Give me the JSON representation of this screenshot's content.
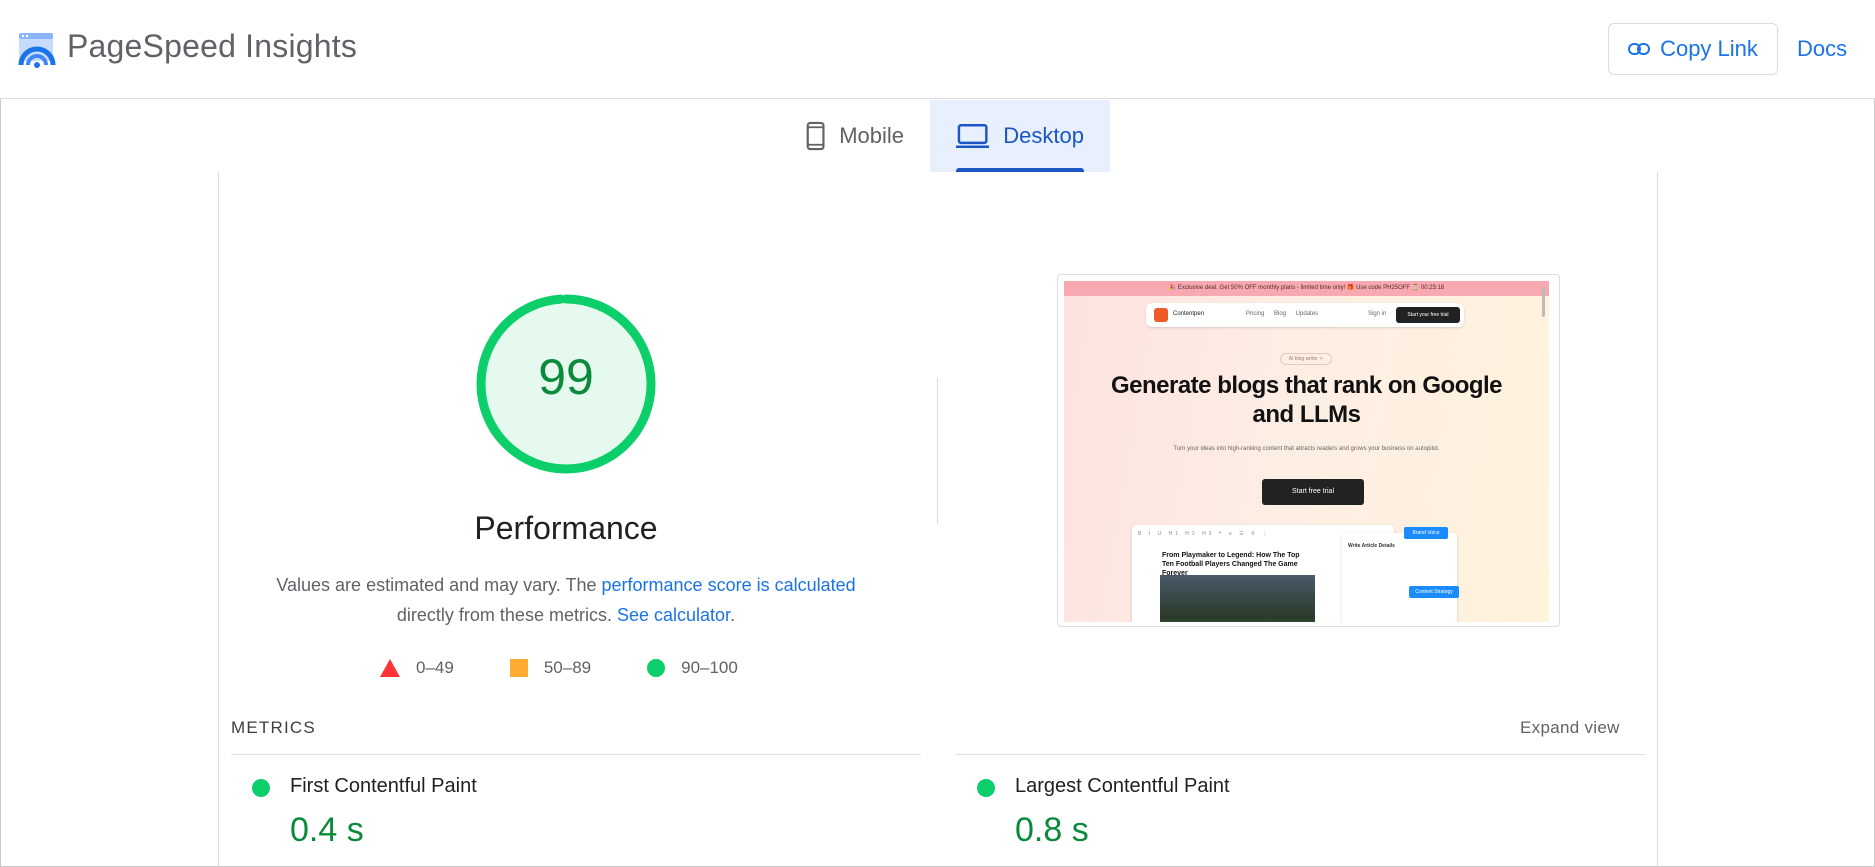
{
  "header": {
    "app_title": "PageSpeed Insights",
    "copy_link_label": "Copy Link",
    "docs_label": "Docs"
  },
  "tabs": [
    {
      "label": "Mobile",
      "icon": "smartphone-icon",
      "active": false
    },
    {
      "label": "Desktop",
      "icon": "laptop-icon",
      "active": true
    }
  ],
  "performance": {
    "score": "99",
    "score_value": 99,
    "title": "Performance",
    "desc_prefix": "Values are estimated and may vary. The ",
    "desc_link": "performance score is calculated",
    "desc_middle": "directly from these metrics.",
    "calculator_link": "See calculator",
    "desc_suffix": "."
  },
  "legend": [
    {
      "range": "0–49",
      "shape": "triangle",
      "color": "#ff3333"
    },
    {
      "range": "50–89",
      "shape": "square",
      "color": "#ffaa33"
    },
    {
      "range": "90–100",
      "shape": "circle",
      "color": "#0cce6b"
    }
  ],
  "screenshot": {
    "banner": "🎉 Exclusive deal. Get 50% OFF monthly plans - limited time only! 🎁 Use code PH25OFF ⏳ 00:25:18",
    "brand": "Contentpen",
    "nav_links": "Pricing Blog Updates",
    "sign_in": "Sign in",
    "nav_cta": "Start your free trial",
    "pill": "AI blog writer ✧",
    "headline": "Generate blogs that rank on Google and LLMs",
    "subhead": "Turn your ideas into high-ranking content that attracts readers and grows your business on autopilot.",
    "cta": "Start free trial",
    "editor_toolbar": "B I U H1 H2 H3 ❝ ≡ ☰ ⚲ ⋮",
    "editor_title": "From Playmaker to Legend: How The Top Ten Football Players Changed The Game Forever",
    "panel_title": "Write Article Details",
    "brand_voice_btn": "Brand Voice",
    "content_strategy_btn": "Content Strategy"
  },
  "metrics": {
    "section_label": "METRICS",
    "expand_label": "Expand view",
    "items": [
      {
        "name": "First Contentful Paint",
        "value": "0.4 s",
        "status_color": "#0cce6b"
      },
      {
        "name": "Largest Contentful Paint",
        "value": "0.8 s",
        "status_color": "#0cce6b"
      }
    ]
  },
  "colors": {
    "accent": "#1a73e8",
    "good": "#0cce6b",
    "good_text": "#0a8a3a"
  }
}
